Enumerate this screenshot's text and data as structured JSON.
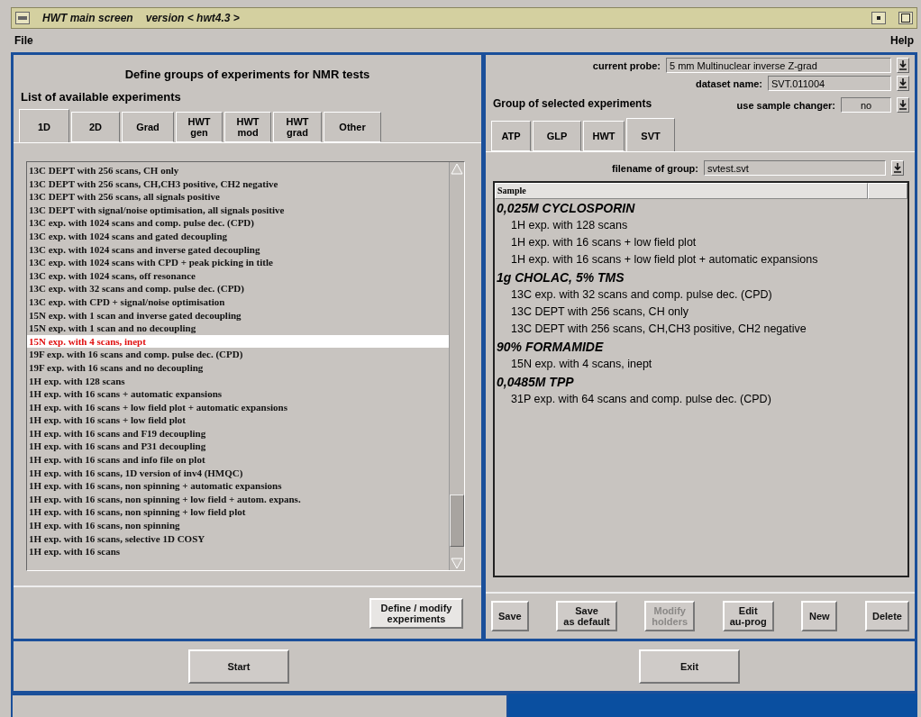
{
  "window": {
    "title": "HWT main screen",
    "version": "version < hwt4.3 >"
  },
  "menu": [
    {
      "label": "File"
    },
    {
      "label": "Help"
    }
  ],
  "left_panel": {
    "heading": "Define groups of experiments for NMR tests",
    "list_label": "List of available experiments",
    "tabs": [
      {
        "label": "1D",
        "selected": true
      },
      {
        "label": "2D",
        "selected": false
      },
      {
        "label": "Grad",
        "selected": false
      },
      {
        "label": "HWT\ngen",
        "selected": false
      },
      {
        "label": "HWT\nmod",
        "selected": false
      },
      {
        "label": "HWT\ngrad",
        "selected": false
      },
      {
        "label": "Other",
        "selected": false
      }
    ],
    "experiments": [
      {
        "label": "13C DEPT with 256 scans, CH only",
        "selected": false
      },
      {
        "label": "13C DEPT with 256 scans, CH,CH3 positive, CH2 negative",
        "selected": false
      },
      {
        "label": "13C DEPT with 256 scans, all signals positive",
        "selected": false
      },
      {
        "label": "13C DEPT with signal/noise optimisation, all signals positive",
        "selected": false
      },
      {
        "label": "13C exp. with 1024 scans and comp. pulse dec. (CPD)",
        "selected": false
      },
      {
        "label": "13C exp. with 1024 scans and gated decoupling",
        "selected": false
      },
      {
        "label": "13C exp. with 1024 scans and inverse gated decoupling",
        "selected": false
      },
      {
        "label": "13C exp. with 1024 scans with CPD + peak picking in title",
        "selected": false
      },
      {
        "label": "13C exp. with 1024 scans, off resonance",
        "selected": false
      },
      {
        "label": "13C exp. with 32 scans and comp. pulse dec. (CPD)",
        "selected": false
      },
      {
        "label": "13C exp. with CPD + signal/noise optimisation",
        "selected": false
      },
      {
        "label": "15N exp. with 1 scan and inverse gated decoupling",
        "selected": false
      },
      {
        "label": "15N exp. with 1 scan and no decoupling",
        "selected": false
      },
      {
        "label": "15N exp. with 4 scans, inept",
        "selected": true
      },
      {
        "label": "19F exp. with 16 scans and comp. pulse dec. (CPD)",
        "selected": false
      },
      {
        "label": "19F exp. with 16 scans and no decoupling",
        "selected": false
      },
      {
        "label": "1H exp. with 128 scans",
        "selected": false
      },
      {
        "label": "1H exp. with 16 scans + automatic expansions",
        "selected": false
      },
      {
        "label": "1H exp. with 16 scans + low field plot + automatic expansions",
        "selected": false
      },
      {
        "label": "1H exp. with 16 scans + low field plot",
        "selected": false
      },
      {
        "label": "1H exp. with 16 scans and F19 decoupling",
        "selected": false
      },
      {
        "label": "1H exp. with 16 scans and P31 decoupling",
        "selected": false
      },
      {
        "label": "1H exp. with 16 scans and info file on plot",
        "selected": false
      },
      {
        "label": "1H exp. with 16 scans, 1D version of inv4 (HMQC)",
        "selected": false
      },
      {
        "label": "1H exp. with 16 scans, non spinning + automatic expansions",
        "selected": false
      },
      {
        "label": "1H exp. with 16 scans, non spinning + low field + autom. expans.",
        "selected": false
      },
      {
        "label": "1H exp. with 16 scans, non spinning + low field plot",
        "selected": false
      },
      {
        "label": "1H exp. with 16 scans, non spinning",
        "selected": false
      },
      {
        "label": "1H exp. with 16 scans, selective 1D COSY",
        "selected": false
      },
      {
        "label": "1H exp. with 16 scans",
        "selected": false
      }
    ],
    "button": "Define / modify\nexperiments"
  },
  "right_panel": {
    "probe": {
      "label": "current probe:",
      "value": "5 mm Multinuclear inverse Z-grad"
    },
    "dataset": {
      "label": "dataset name:",
      "value": "SVT.011004"
    },
    "group_label": "Group of selected experiments",
    "sample_changer": {
      "label": "use sample changer:",
      "value": "no"
    },
    "tabs": [
      {
        "label": "ATP",
        "selected": false
      },
      {
        "label": "GLP",
        "selected": false
      },
      {
        "label": "HWT",
        "selected": false
      },
      {
        "label": "SVT",
        "selected": true
      }
    ],
    "filename": {
      "label": "filename of group:",
      "value": "svtest.svt"
    },
    "table": {
      "columns": [
        "Sample"
      ],
      "groups": [
        {
          "name": "0,025M CYCLOSPORIN",
          "children": [
            "1H exp. with 128 scans",
            "1H exp. with 16 scans + low field plot",
            "1H exp. with 16 scans + low field plot + automatic expansions"
          ]
        },
        {
          "name": "1g CHOLAC, 5% TMS",
          "children": [
            "13C exp. with 32 scans and comp. pulse dec. (CPD)",
            "13C DEPT with 256 scans, CH only",
            "13C DEPT with 256 scans, CH,CH3 positive, CH2 negative"
          ]
        },
        {
          "name": "90% FORMAMIDE",
          "children": [
            "15N exp. with 4 scans, inept"
          ]
        },
        {
          "name": "0,0485M TPP",
          "children": [
            "31P exp. with 64 scans and comp. pulse dec. (CPD)"
          ]
        }
      ]
    },
    "buttons": [
      {
        "label": "Save",
        "disabled": false
      },
      {
        "label": "Save\nas default",
        "disabled": false
      },
      {
        "label": "Modify\nholders",
        "disabled": true
      },
      {
        "label": "Edit\nau-prog",
        "disabled": false
      },
      {
        "label": "New",
        "disabled": false
      },
      {
        "label": "Delete",
        "disabled": false
      }
    ]
  },
  "bottom_buttons": [
    {
      "label": "Start"
    },
    {
      "label": "Exit"
    }
  ]
}
